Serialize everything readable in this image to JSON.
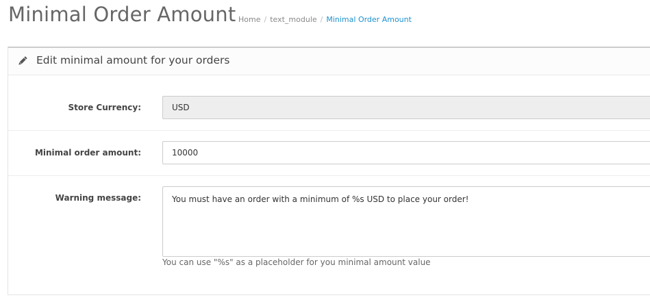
{
  "header": {
    "title": "Minimal Order Amount",
    "breadcrumb": [
      {
        "label": "Home"
      },
      {
        "label": "text_module"
      },
      {
        "label": "Minimal Order Amount"
      }
    ],
    "breadcrumb_separator": "/"
  },
  "panel": {
    "icon": "pencil-icon",
    "title": "Edit minimal amount for your orders"
  },
  "form": {
    "store_currency": {
      "label": "Store Currency:",
      "value": "USD"
    },
    "minimal_order_amount": {
      "label": "Minimal order amount:",
      "value": "10000"
    },
    "warning_message": {
      "label": "Warning message:",
      "value": "You must have an order with a minimum of %s USD to place your order!",
      "help": "You can use \"%s\" as a placeholder for you minimal amount value"
    }
  },
  "colors": {
    "title": "#666666",
    "breadcrumb_active": "#1e91cf",
    "readonly_background": "#eeeeee"
  }
}
